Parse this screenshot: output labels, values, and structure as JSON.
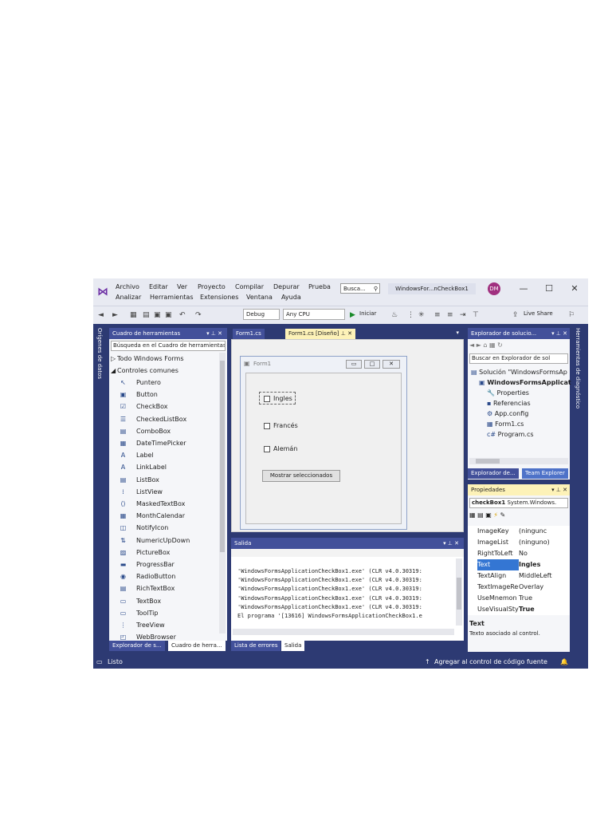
{
  "menu": {
    "row1": [
      "Archivo",
      "Editar",
      "Ver",
      "Proyecto",
      "Compilar",
      "Depurar",
      "Prueba"
    ],
    "row2": [
      "Analizar",
      "Herramientas",
      "Extensiones",
      "Ventana",
      "Ayuda"
    ]
  },
  "title": {
    "search_placeholder": "Busca...",
    "window_title": "WindowsFor...nCheckBox1",
    "avatar_initials": "DM"
  },
  "toolbar": {
    "config": "Debug",
    "platform": "Any CPU",
    "start_label": "Iniciar",
    "live_share": "Live Share"
  },
  "side_tabs": {
    "left": "Orígenes de datos",
    "right": "Herramientas de diagnóstico"
  },
  "toolbox": {
    "title": "Cuadro de herramientas",
    "search_placeholder": "Búsqueda en el Cuadro de herramientas",
    "group_all": "Todo Windows Forms",
    "group_common": "Controles comunes",
    "items": [
      {
        "label": "Puntero",
        "icon": "pointer-icon"
      },
      {
        "label": "Button",
        "icon": "button-icon"
      },
      {
        "label": "CheckBox",
        "icon": "checkbox-icon"
      },
      {
        "label": "CheckedListBox",
        "icon": "checkedlistbox-icon"
      },
      {
        "label": "ComboBox",
        "icon": "combobox-icon"
      },
      {
        "label": "DateTimePicker",
        "icon": "datetimepicker-icon"
      },
      {
        "label": "Label",
        "icon": "label-icon"
      },
      {
        "label": "LinkLabel",
        "icon": "linklabel-icon"
      },
      {
        "label": "ListBox",
        "icon": "listbox-icon"
      },
      {
        "label": "ListView",
        "icon": "listview-icon"
      },
      {
        "label": "MaskedTextBox",
        "icon": "maskedtextbox-icon"
      },
      {
        "label": "MonthCalendar",
        "icon": "monthcalendar-icon"
      },
      {
        "label": "NotifyIcon",
        "icon": "notifyicon-icon"
      },
      {
        "label": "NumericUpDown",
        "icon": "numericupdown-icon"
      },
      {
        "label": "PictureBox",
        "icon": "picturebox-icon"
      },
      {
        "label": "ProgressBar",
        "icon": "progressbar-icon"
      },
      {
        "label": "RadioButton",
        "icon": "radiobutton-icon"
      },
      {
        "label": "RichTextBox",
        "icon": "richtextbox-icon"
      },
      {
        "label": "TextBox",
        "icon": "textbox-icon"
      },
      {
        "label": "ToolTip",
        "icon": "tooltip-icon"
      },
      {
        "label": "TreeView",
        "icon": "treeview-icon"
      },
      {
        "label": "WebBrowser",
        "icon": "webbrowser-icon"
      }
    ],
    "bottom_tabs": [
      "Explorador de s...",
      "Cuadro de herra..."
    ]
  },
  "editor": {
    "tabs": [
      "Form1.cs",
      "Form1.cs [Diseño]"
    ],
    "form_title": "Form1",
    "checkboxes": [
      "Ingles",
      "Francés",
      "Alemán"
    ],
    "button_label": "Mostrar seleccionados"
  },
  "output": {
    "title": "Salida",
    "lines": [
      "'WindowsFormsApplicationCheckBox1.exe' (CLR v4.0.30319:",
      "'WindowsFormsApplicationCheckBox1.exe' (CLR v4.0.30319:",
      "'WindowsFormsApplicationCheckBox1.exe' (CLR v4.0.30319:",
      "'WindowsFormsApplicationCheckBox1.exe' (CLR v4.0.30319:",
      "'WindowsFormsApplicationCheckBox1.exe' (CLR v4.0.30319:",
      "El programa '[13616] WindowsFormsApplicationCheckBox1.e"
    ],
    "bottom_tabs": [
      "Lista de errores",
      "Salida"
    ]
  },
  "solution": {
    "title": "Explorador de solucio...",
    "search_placeholder": "Buscar en Explorador de sol",
    "items": [
      {
        "label": "Solución \"WindowsFormsAp",
        "indent": 0
      },
      {
        "label": "WindowsFormsApplicat",
        "indent": 1
      },
      {
        "label": "Properties",
        "indent": 2
      },
      {
        "label": "Referencias",
        "indent": 2
      },
      {
        "label": "App.config",
        "indent": 2
      },
      {
        "label": "Form1.cs",
        "indent": 2
      },
      {
        "label": "Program.cs",
        "indent": 2
      }
    ],
    "bottom_tabs": [
      "Explorador de...",
      "Team Explorer"
    ]
  },
  "properties": {
    "title": "Propiedades",
    "object_name": "checkBox1",
    "object_type": "System.Windows.",
    "rows": [
      {
        "name": "ImageKey",
        "value": "(ningunc"
      },
      {
        "name": "ImageList",
        "value": "(ninguno)"
      },
      {
        "name": "RightToLeft",
        "value": "No"
      },
      {
        "name": "Text",
        "value": "Ingles"
      },
      {
        "name": "TextAlign",
        "value": "MiddleLeft"
      },
      {
        "name": "TextImageRe",
        "value": "Overlay"
      },
      {
        "name": "UseMnemon",
        "value": "True"
      },
      {
        "name": "UseVisualStyl",
        "value": "True"
      }
    ],
    "desc_title": "Text",
    "desc_text": "Texto asociado al control."
  },
  "status": {
    "ready": "Listo",
    "source_control": "Agregar al control de código fuente"
  },
  "colors": {
    "ide_frame": "#2d3a73",
    "panel_header": "#42509a",
    "selection": "#3476d3",
    "accent_purple": "#6c2ea4"
  }
}
